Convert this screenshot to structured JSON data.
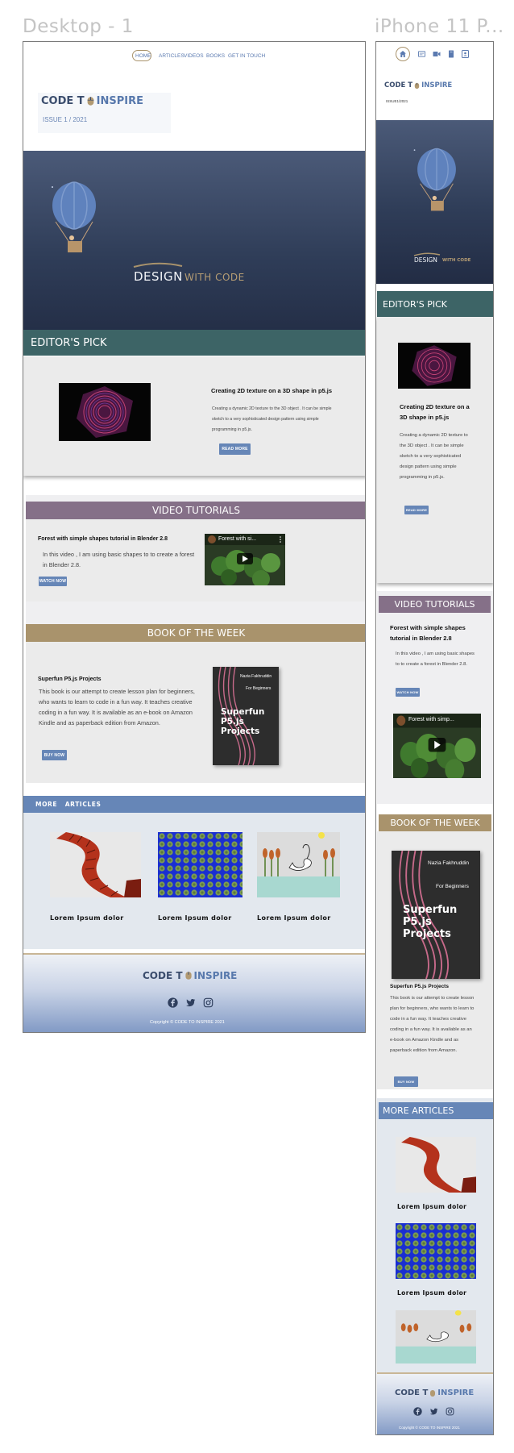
{
  "frames": {
    "desktop_label": "Desktop - 1",
    "mobile_label": "iPhone 11 P..."
  },
  "brand": {
    "logo_left": "CODE T",
    "logo_right": "INSPIRE",
    "issue_desktop": "ISSUE 1 / 2021",
    "issue_mobile": "ISSUE1/2021"
  },
  "nav": {
    "home": "HOME",
    "articles": "ARTICLES",
    "videos": "VIDEOS",
    "books": "BOOKS",
    "contact": "GET IN TOUCH"
  },
  "hero": {
    "design": "DESIGN",
    "with_code": "WITH CODE"
  },
  "editors_pick": {
    "heading": "EDITOR'S PICK",
    "title": "Creating 2D texture on a 3D shape in p5.js",
    "description": "Creating a dynamic 2D texture to the 3D object . It can be simple sketch to a very sophisticated design pattern using simple programming in p5.js.",
    "button": "READ MORE"
  },
  "video": {
    "heading": "VIDEO TUTORIALS",
    "title": "Forest with simple shapes tutorial in Blender 2.8",
    "description": "In this video , I am using basic shapes to to create a forest in Blender 2.8.",
    "button": "WATCH NOW",
    "thumb_title_desktop": "Forest with si...",
    "thumb_title_mobile": "Forest with simp..."
  },
  "book": {
    "heading": "BOOK OF THE WEEK",
    "title": "Superfun P5.js Projects",
    "description": "This book is our attempt to create lesson plan for beginners, who wants to learn to code in a fun way. It teaches creative coding in a fun way. It is available as an e-book on Amazon Kindle and as paperback edition from Amazon.",
    "button": "BUY NOW",
    "cover_author": "Nazia Fakhruddin",
    "cover_subtitle": "For Beginners",
    "cover_title_1": "Superfun",
    "cover_title_2": "P5.js",
    "cover_title_3": "Projects"
  },
  "more_articles": {
    "heading_desktop": "MORE   ARTICLES",
    "heading_mobile": "MORE ARTICLES",
    "items": [
      {
        "title": "Lorem Ipsum dolor"
      },
      {
        "title": "Lorem Ipsum dolor"
      },
      {
        "title": "Lorem Ipsum dolor"
      }
    ]
  },
  "footer": {
    "copyright": "Copyright © CODE TO INSPIRE 2021"
  },
  "colors": {
    "accent_blue": "#6686b7",
    "teal": "#3d6466",
    "purple": "#857088",
    "gold": "#a9936c",
    "navy_dark": "#24304a"
  }
}
